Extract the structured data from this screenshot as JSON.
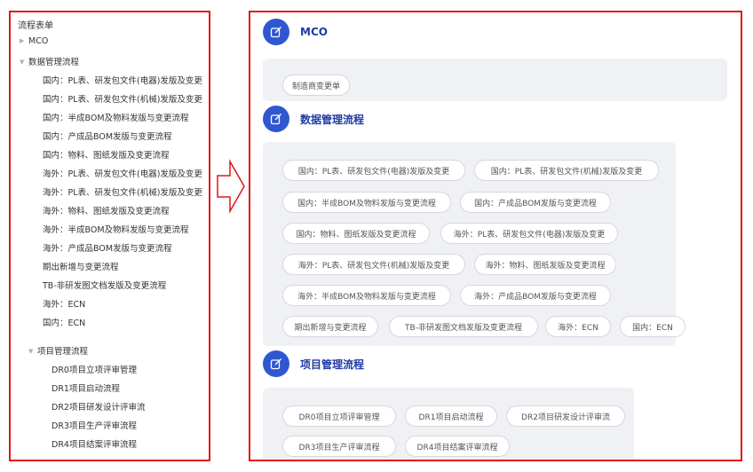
{
  "tree": {
    "root_label": "流程表单",
    "mco_label": "MCO",
    "data_group_label": "数据管理流程",
    "data_items": [
      "国内：PL表、研发包文件(电器)发版及变更",
      "国内：PL表、研发包文件(机械)发版及变更",
      "国内：半成BOM及物料发版与变更流程",
      "国内：产成品BOM发版与变更流程",
      "国内：物料、图纸发版及变更流程",
      "海外：PL表、研发包文件(电器)发版及变更",
      "海外：PL表、研发包文件(机械)发版及变更",
      "海外：物料、图纸发版及变更流程",
      "海外：半成BOM及物料发版与变更流程",
      "海外：产成品BOM发版与变更流程",
      "期出新增与变更流程",
      "TB-非研发图文档发版及变更流程",
      "海外：ECN",
      "国内：ECN"
    ],
    "project_group_label": "项目管理流程",
    "project_items": [
      "DR0项目立项评审管理",
      "DR1项目启动流程",
      "DR2项目研发设计评审流",
      "DR3项目生产评审流程",
      "DR4项目结案评审流程"
    ]
  },
  "sections": {
    "mco": {
      "title": "MCO",
      "tags": [
        "制造商变更单"
      ]
    },
    "data": {
      "title": "数据管理流程",
      "tags": [
        "国内：PL表、研发包文件(电器)发版及变更",
        "国内：PL表、研发包文件(机械)发版及变更",
        "国内：半成BOM及物料发版与变更流程",
        "国内：产成品BOM发版与变更流程",
        "国内：物料、图纸发版及变更流程",
        "海外：PL表、研发包文件(电器)发版及变更",
        "海外：PL表、研发包文件(机械)发版及变更",
        "海外：物料、图纸发版及变更流程",
        "海外：半成BOM及物料发版与变更流程",
        "海外：产成品BOM发版与变更流程",
        "期出新增与变更流程",
        "TB-非研发图文档发版及变更流程",
        "海外：ECN",
        "国内：ECN"
      ]
    },
    "project": {
      "title": "项目管理流程",
      "tags": [
        "DR0项目立项评审管理",
        "DR1项目启动流程",
        "DR2项目研发设计评审流",
        "DR3项目生产评审流程",
        "DR4项目结案评审流程"
      ]
    }
  },
  "colors": {
    "highlight_border": "#e0161b",
    "accent": "#2f57d1",
    "title_text": "#1f3aa6"
  },
  "icons": {
    "section_icon": "edit-icon",
    "collapsed": "caret-right-icon",
    "expanded": "caret-down-icon",
    "arrow": "right-arrow-icon"
  }
}
